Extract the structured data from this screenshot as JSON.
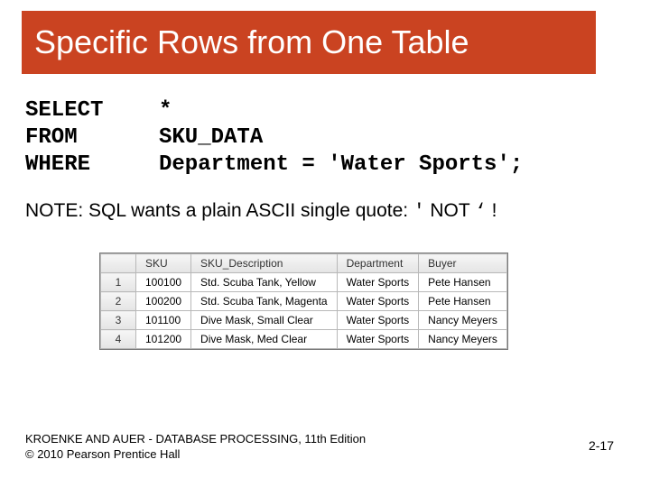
{
  "title": "Specific Rows from One Table",
  "sql": {
    "kw1": "SELECT",
    "arg1": "*",
    "kw2": "FROM",
    "arg2": "SKU_DATA",
    "kw3": "WHERE",
    "arg3": "Department = 'Water Sports';"
  },
  "note": {
    "prefix": "NOTE:  SQL wants a plain ASCII single quote:  ",
    "good": "'",
    "mid": " NOT  ",
    "bad": "‘",
    "end": "  !"
  },
  "table": {
    "headers": [
      "SKU",
      "SKU_Description",
      "Department",
      "Buyer"
    ],
    "rows": [
      {
        "n": "1",
        "cells": [
          "100100",
          "Std. Scuba Tank, Yellow",
          "Water Sports",
          "Pete Hansen"
        ]
      },
      {
        "n": "2",
        "cells": [
          "100200",
          "Std. Scuba Tank, Magenta",
          "Water Sports",
          "Pete Hansen"
        ]
      },
      {
        "n": "3",
        "cells": [
          "101100",
          "Dive Mask, Small Clear",
          "Water Sports",
          "Nancy Meyers"
        ]
      },
      {
        "n": "4",
        "cells": [
          "101200",
          "Dive Mask, Med Clear",
          "Water Sports",
          "Nancy Meyers"
        ]
      }
    ]
  },
  "footer": {
    "line1": "KROENKE AND AUER - DATABASE PROCESSING, 11th Edition",
    "line2": "© 2010 Pearson Prentice Hall",
    "page": "2-17"
  }
}
